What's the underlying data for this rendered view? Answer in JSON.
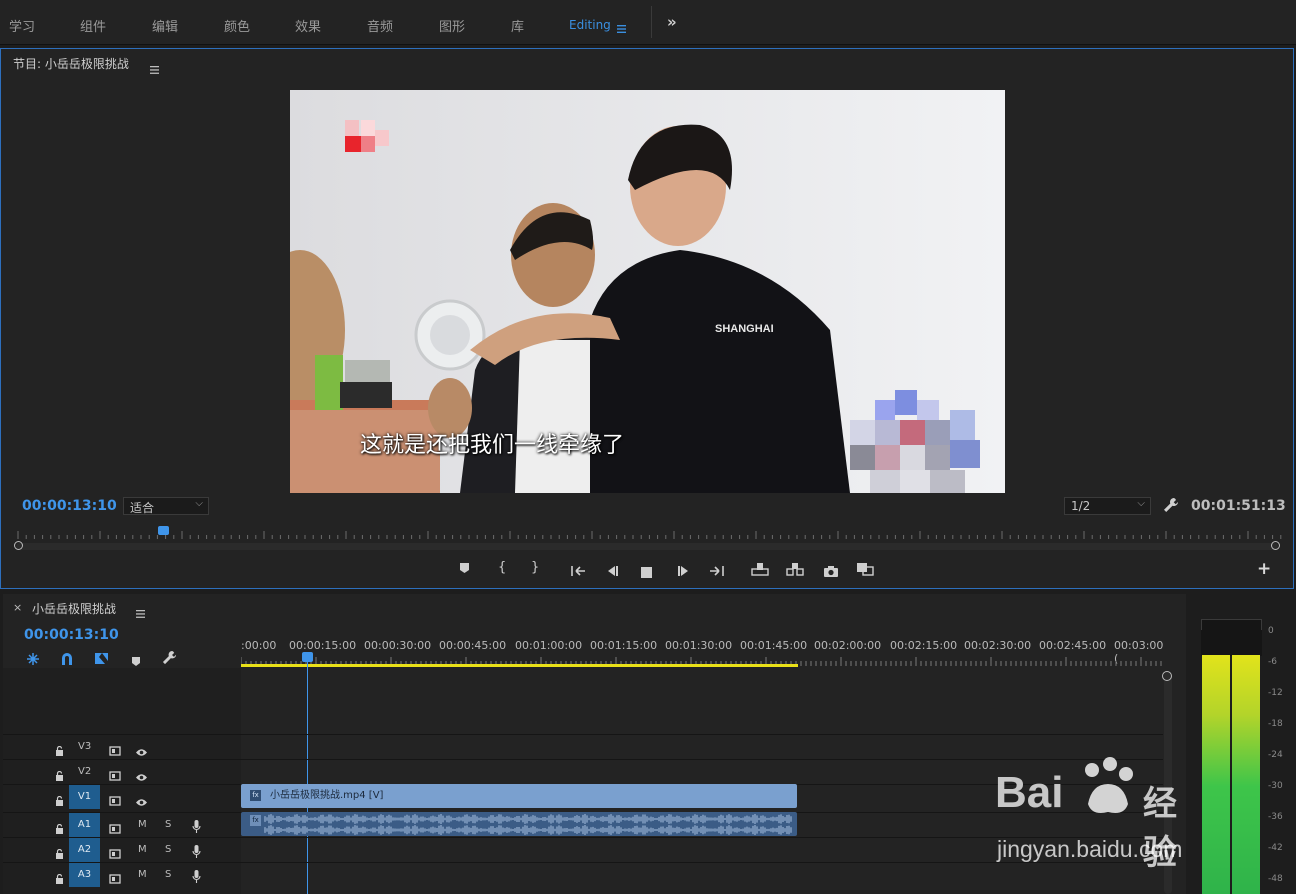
{
  "workspaces": [
    {
      "label": "学习"
    },
    {
      "label": "组件"
    },
    {
      "label": "编辑"
    },
    {
      "label": "颜色"
    },
    {
      "label": "效果"
    },
    {
      "label": "音频"
    },
    {
      "label": "图形"
    },
    {
      "label": "库"
    },
    {
      "label": "Editing"
    }
  ],
  "workspace_menu_icon": "hamburger-icon",
  "overflow_label": "»",
  "monitor": {
    "title": "节目: 小岳岳极限挑战",
    "menu_icon": "hamburger-icon",
    "subtitle": "这就是还把我们一线牵缘了",
    "shirt_text": "SHANGHAI",
    "current_time": "00:00:13:10",
    "zoom": "适合",
    "resolution": "1/2",
    "duration": "00:01:51:13",
    "playhead_fraction": 0.103
  },
  "transport": {
    "buttons": [
      "marker",
      "mark-in",
      "mark-out",
      "go-to-in",
      "step-back",
      "stop",
      "step-forward",
      "go-to-out",
      "lift",
      "extract",
      "export-frame",
      "compare"
    ],
    "labels": {
      "mark_in": "{",
      "mark_out": "}",
      "add": "+"
    }
  },
  "timeline": {
    "close": "×",
    "title": "小岳岳极限挑战",
    "current_time": "00:00:13:10",
    "ruler": [
      ":00:00",
      "00:00:15:00",
      "00:00:30:00",
      "00:00:45:00",
      "00:01:00:00",
      "00:01:15:00",
      "00:01:30:00",
      "00:01:45:00",
      "00:02:00:00",
      "00:02:15:00",
      "00:02:30:00",
      "00:02:45:00",
      "00:03:00:("
    ],
    "tracks": [
      {
        "src": "",
        "name": "V3",
        "eye": true
      },
      {
        "src": "",
        "name": "V2",
        "eye": true
      },
      {
        "src": "V1",
        "name": "V1",
        "eye": true
      },
      {
        "src": "A1",
        "name": "A1",
        "m": "M",
        "s": "S"
      },
      {
        "src": "A2",
        "name": "A2",
        "m": "M",
        "s": "S"
      },
      {
        "src": "A3",
        "name": "A3",
        "m": "M",
        "s": "S"
      }
    ],
    "clip_label": "小岳岳极限挑战.mp4 [V]",
    "clip_fx": "fx"
  },
  "meters": {
    "scale": [
      "0",
      "-6",
      "-12",
      "-18",
      "-24",
      "-30",
      "-36",
      "-42",
      "-48"
    ]
  },
  "watermark": {
    "brand": "Bai",
    "brand2": "经验",
    "url": "jingyan.baidu.com"
  },
  "colors": {
    "accent": "#3f95ea",
    "clip_video": "#7aa0cf",
    "clip_audio": "#3b5c86",
    "work_area": "#e9e018"
  }
}
